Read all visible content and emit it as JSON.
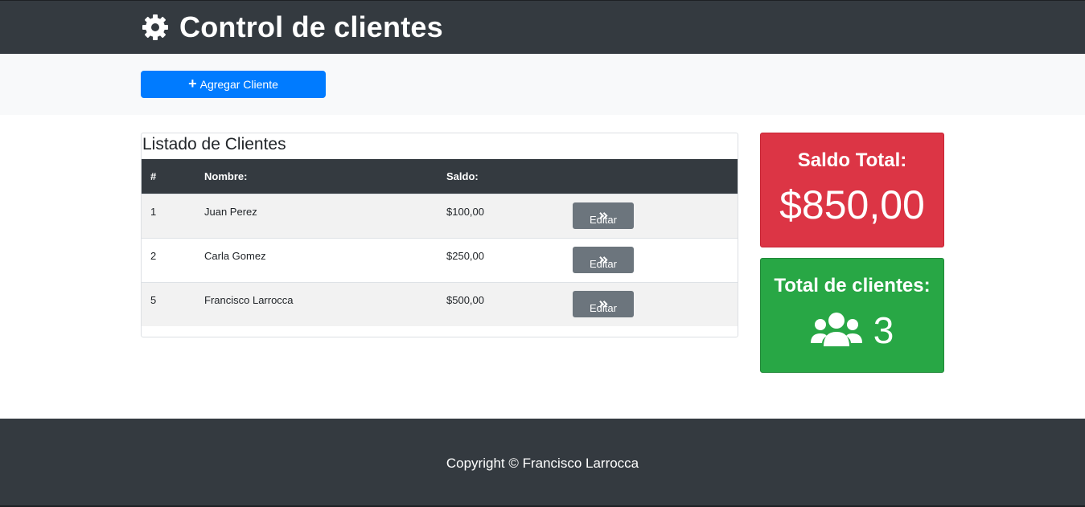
{
  "header": {
    "title": "Control de clientes",
    "icon": "gear-icon"
  },
  "actions": {
    "add_label": "Agregar Cliente",
    "add_icon": "plus-icon"
  },
  "clients_card": {
    "title": "Listado de Clientes",
    "columns": [
      "#",
      "Nombre:",
      "Saldo:",
      ""
    ],
    "rows": [
      {
        "id": "1",
        "name": "Juan Perez",
        "balance": "$100,00",
        "action": "Editar"
      },
      {
        "id": "2",
        "name": "Carla Gomez",
        "balance": "$250,00",
        "action": "Editar"
      },
      {
        "id": "5",
        "name": "Francisco Larrocca",
        "balance": "$500,00",
        "action": "Editar"
      }
    ]
  },
  "saldo_card": {
    "title": "Saldo Total:",
    "value": "$850,00",
    "color": "#dc3545"
  },
  "clientes_card": {
    "title": "Total de clientes:",
    "value": "3",
    "icon": "users-icon",
    "color": "#28a745"
  },
  "footer": {
    "copyright": "Copyright © Francisco Larrocca"
  },
  "colors": {
    "dark": "#343a40",
    "primary": "#007bff",
    "secondary": "#6c757d"
  }
}
